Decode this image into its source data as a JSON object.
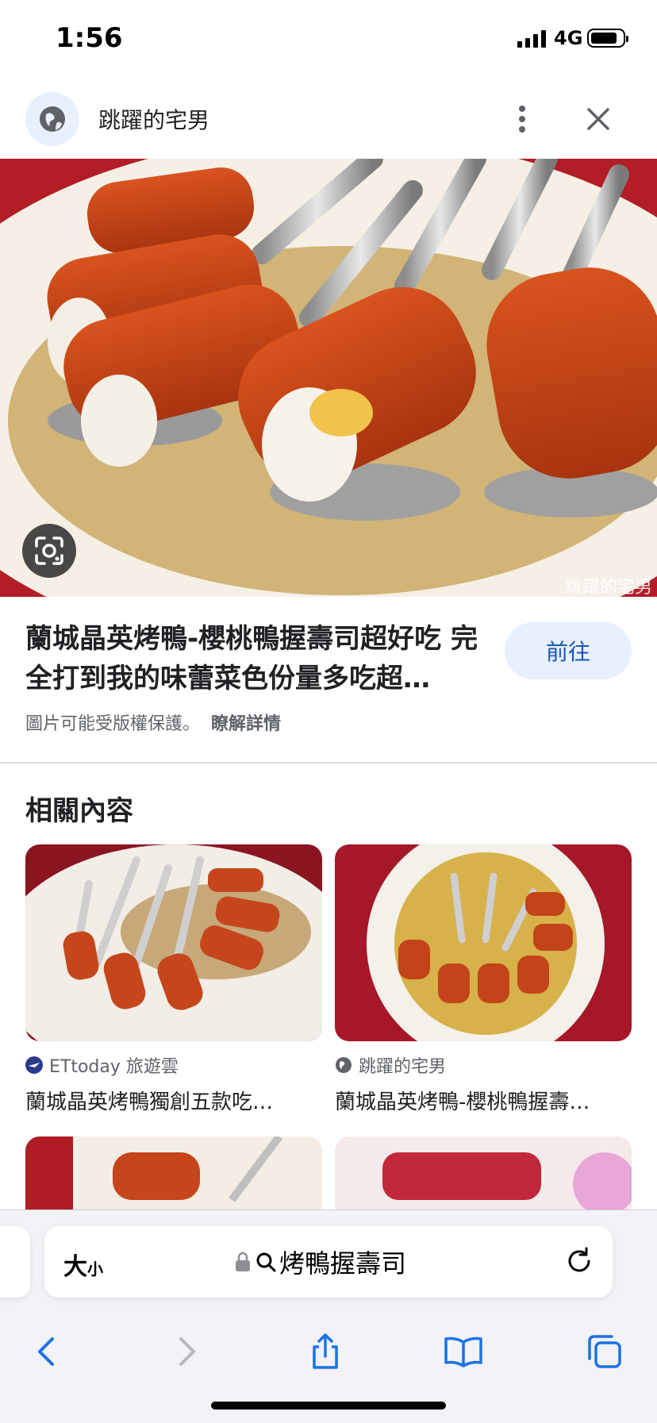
{
  "status_bar": {
    "time": "1:56",
    "network": "4G"
  },
  "header": {
    "site_name": "跳躍的宅男"
  },
  "hero": {
    "watermark": "跳躍的宅男"
  },
  "result": {
    "title": "蘭城晶英烤鴨-櫻桃鴨握壽司超好吃 完全打到我的味蕾菜色份量多吃超…",
    "visit_label": "前往",
    "copyright_text": "圖片可能受版權保護。",
    "learn_more": "瞭解詳情"
  },
  "related": {
    "heading": "相關內容",
    "items": [
      {
        "source": "ETtoday 旅遊雲",
        "title": "蘭城晶英烤鴨獨創五款吃…",
        "source_icon": "ettoday-icon"
      },
      {
        "source": "跳躍的宅男",
        "title": "蘭城晶英烤鴨-櫻桃鴨握壽…",
        "source_icon": "globe-icon"
      }
    ]
  },
  "browser": {
    "text_size": "大",
    "text_size_small": "小",
    "query": "烤鴨握壽司"
  },
  "colors": {
    "accent": "#1a56b8",
    "chip_bg": "#e8f0fe"
  }
}
